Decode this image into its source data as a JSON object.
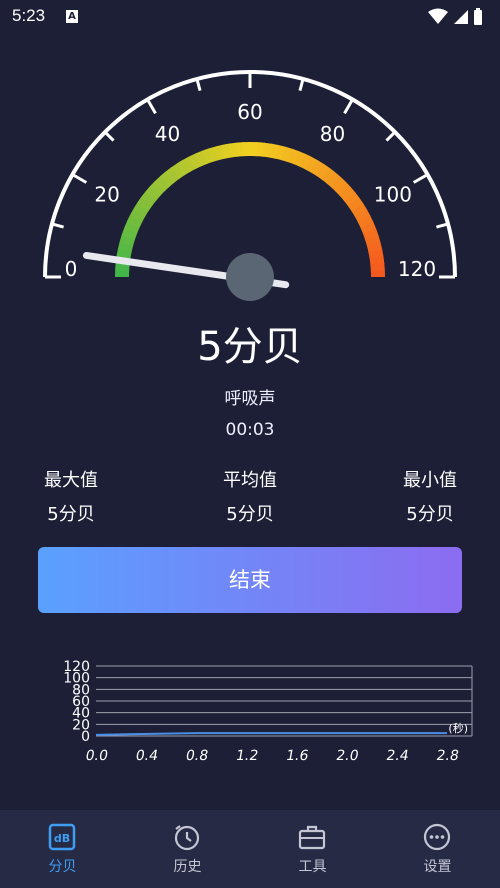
{
  "status_bar": {
    "time": "5:23",
    "notification_letter": "A"
  },
  "meter": {
    "scale_labels": [
      "0",
      "20",
      "40",
      "60",
      "80",
      "100",
      "120"
    ],
    "current_value": 5,
    "value_text": "5分贝",
    "sound_type": "呼吸声",
    "elapsed": "00:03",
    "colors": {
      "low": "#3fb54a",
      "mid": "#f2d020",
      "high": "#f5561f"
    }
  },
  "stats": {
    "max_label": "最大值",
    "max_value": "5分贝",
    "avg_label": "平均值",
    "avg_value": "5分贝",
    "min_label": "最小值",
    "min_value": "5分贝"
  },
  "end_button": {
    "label": "结束"
  },
  "chart_data": {
    "type": "line",
    "x_ticks": [
      "0.0",
      "0.4",
      "0.8",
      "1.2",
      "1.6",
      "2.0",
      "2.4",
      "2.8"
    ],
    "y_ticks": [
      "0",
      "20",
      "40",
      "60",
      "80",
      "100",
      "120"
    ],
    "unit_label": "(秒)",
    "ylim": [
      0,
      120
    ],
    "xlim": [
      0,
      3.0
    ],
    "series": [
      {
        "x": [
          0.0,
          0.8,
          2.8
        ],
        "values": [
          2,
          5,
          5
        ]
      }
    ],
    "line_color": "#4a8fe7"
  },
  "tabs": [
    {
      "label": "分贝",
      "icon": "db-icon",
      "active": true
    },
    {
      "label": "历史",
      "icon": "history-icon",
      "active": false
    },
    {
      "label": "工具",
      "icon": "toolbox-icon",
      "active": false
    },
    {
      "label": "设置",
      "icon": "settings-icon",
      "active": false
    }
  ]
}
